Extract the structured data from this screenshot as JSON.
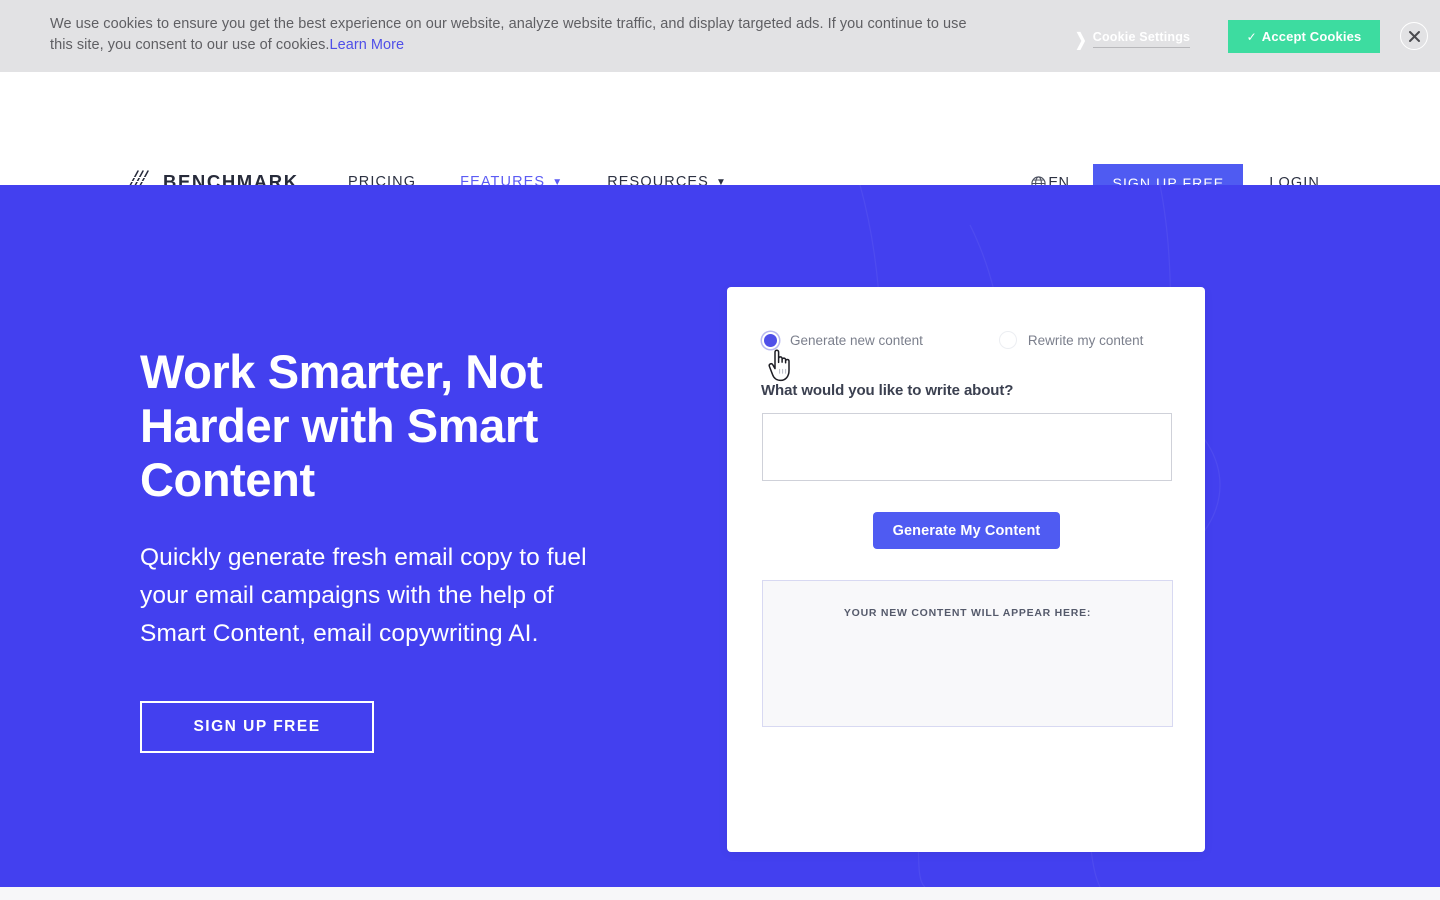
{
  "cookie_banner": {
    "message_line1": "We use cookies to ensure you get the best experience on our website, analyze website traffic, and display targeted ads. If you continue to use",
    "message_line2": "this site, you consent to our use of cookies.",
    "learn_more_label": "Learn More",
    "settings_label": "Cookie Settings",
    "settings_chevron": "❯",
    "accept_label": "Accept Cookies",
    "accept_check": "✓",
    "close_icon_name": "close-icon",
    "accent_color": "#3ddca0",
    "background_color": "#e2e2e4"
  },
  "navbar": {
    "logo_text": "BENCHMARK",
    "logo_icon_name": "benchmark-slashes-logo",
    "links": [
      {
        "label": "PRICING",
        "has_caret": false,
        "active": false
      },
      {
        "label": "FEATURES",
        "has_caret": true,
        "active": true
      },
      {
        "label": "RESOURCES",
        "has_caret": true,
        "active": false
      }
    ],
    "caret_glyph": "▼",
    "language": "EN",
    "language_icon_name": "globe-icon",
    "signup_label": "SIGN UP FREE",
    "login_label": "LOGIN",
    "accent_color": "#4f5bf2",
    "active_link_color": "#5b5bf4"
  },
  "hero": {
    "title": "Work Smarter, Not Harder with Smart Content",
    "subtitle": "Quickly generate fresh email copy to fuel your email campaigns with the help of Smart Content, email copywriting AI.",
    "cta_label": "SIGN UP FREE",
    "background_color": "#4340ef"
  },
  "product_card": {
    "radio_options": [
      {
        "label": "Generate new content",
        "selected": true
      },
      {
        "label": "Rewrite my content",
        "selected": false
      }
    ],
    "question_label": "What would you like to write about?",
    "prompt_value": "",
    "prompt_placeholder": "",
    "generate_button_label": "Generate My Content",
    "output_placeholder": "YOUR NEW CONTENT WILL APPEAR HERE:",
    "cursor_icon_name": "pointing-hand-cursor",
    "button_color": "#4f5bf2",
    "selected_radio_color": "#4f4fe8"
  }
}
